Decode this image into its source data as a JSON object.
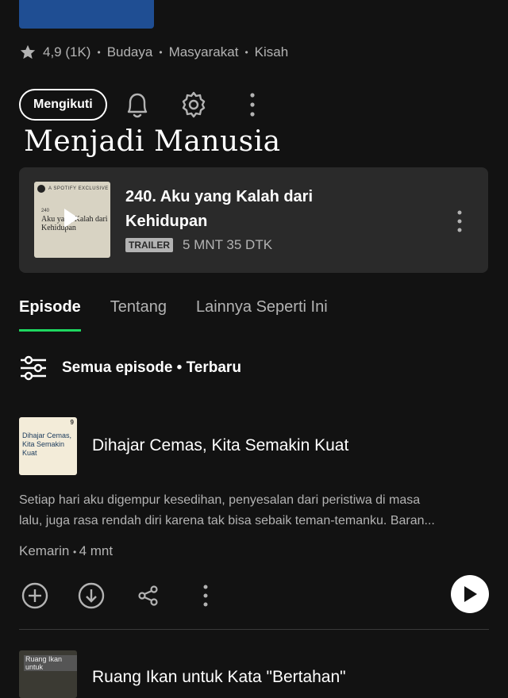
{
  "show": {
    "rating": "4,9 (1K)",
    "categories": [
      "Budaya",
      "Masyarakat",
      "Kisah"
    ],
    "follow_label": "Mengikuti",
    "title": "Menjadi Manusia"
  },
  "trailer": {
    "title": "240. Aku yang Kalah dari Kehidupan",
    "badge": "TRAILER",
    "duration": "5 MNT 35 DTK",
    "art_top_label": "A SPOTIFY EXCLUSIVE",
    "art_number": "240",
    "art_title": "Aku yang Kalah dari Kehidupan"
  },
  "tabs": [
    {
      "label": "Episode",
      "active": true
    },
    {
      "label": "Tentang",
      "active": false
    },
    {
      "label": "Lainnya Seperti Ini",
      "active": false
    }
  ],
  "filter": {
    "label": "Semua episode • Terbaru"
  },
  "episode": {
    "title": "Dihajar Cemas, Kita Semakin Kuat",
    "art_title": "Dihajar Cemas, Kita Semakin Kuat",
    "description_line1": "Setiap hari aku digempur kesedihan, penyesalan dari peristiwa di masa",
    "description_line2": "lalu, juga rasa rendah diri karena tak bisa sebaik teman-temanku. Baran...",
    "date": "Kemarin",
    "length": "4 mnt"
  },
  "next_episode": {
    "title": "Ruang Ikan untuk Kata \"Bertahan\"",
    "art_title": "Ruang Ikan untuk"
  },
  "colors": {
    "background": "#121212",
    "card": "#2a2a2a",
    "accent": "#1ed760",
    "muted": "#b3b3b3"
  },
  "icons": {
    "rating": "star-icon",
    "notify": "bell-icon",
    "settings": "gear-icon",
    "more": "more-vertical-icon",
    "filter": "sliders-icon",
    "add": "plus-circle-icon",
    "download": "download-icon",
    "share": "share-icon",
    "play": "play-icon"
  }
}
